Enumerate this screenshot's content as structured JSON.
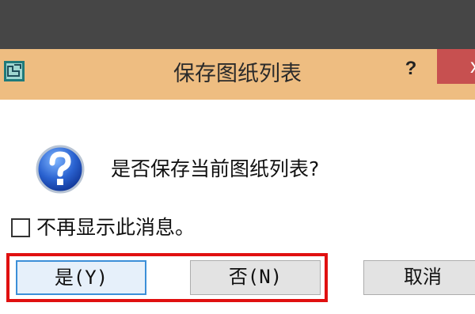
{
  "window": {
    "title": "保存图纸列表",
    "help_label": "?",
    "close_label": "x"
  },
  "dialog": {
    "message": "是否保存当前图纸列表?",
    "checkbox_label": "不再显示此消息。",
    "checkbox_checked": false
  },
  "buttons": {
    "yes": "是(Y)",
    "no": "否(N)",
    "cancel": "取消"
  },
  "colors": {
    "titlebar": "#eebd81",
    "close": "#c75050",
    "highlight": "#e01010",
    "default_button_border": "#3c8fd8"
  }
}
